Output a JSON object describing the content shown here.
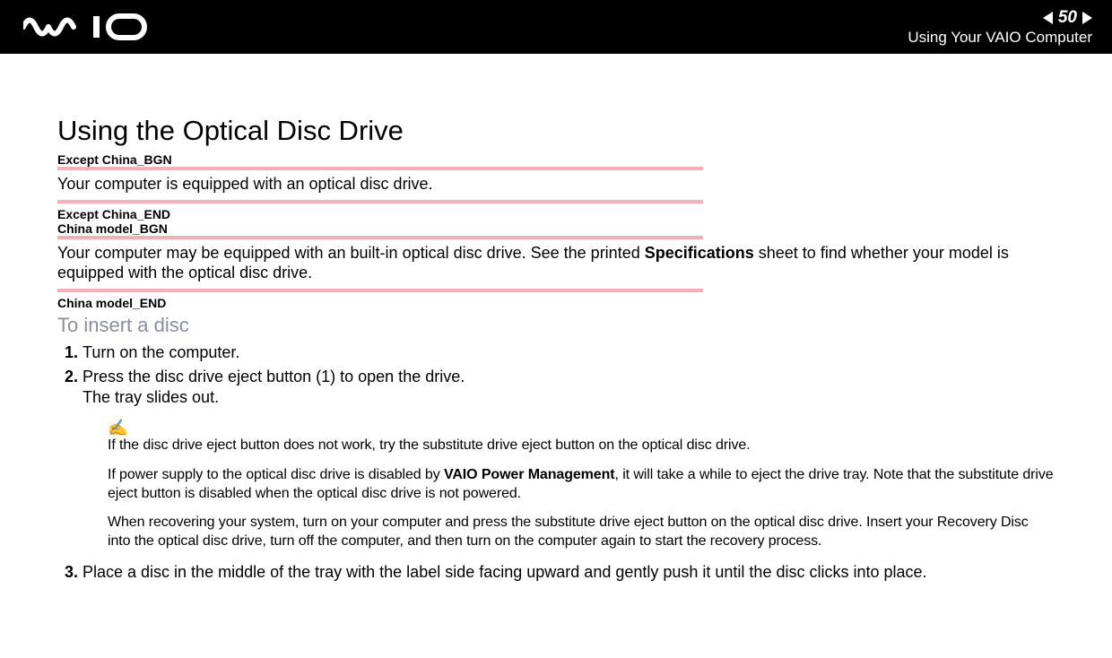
{
  "header": {
    "page_number": "50",
    "subtitle": "Using Your VAIO Computer"
  },
  "title": "Using the Optical Disc Drive",
  "markers": {
    "except_china_bgn": "Except China_BGN",
    "except_china_end": "Except China_END",
    "china_model_bgn": "China model_BGN",
    "china_model_end": "China model_END"
  },
  "para1": "Your computer is equipped with an optical disc drive.",
  "para2_pre": "Your computer may be equipped with an built-in optical disc drive. See the printed ",
  "para2_bold": "Specifications",
  "para2_post": " sheet to find whether your model is equipped with the optical disc drive.",
  "subheading": "To insert a disc",
  "steps": {
    "s1": "Turn on the computer.",
    "s2a": "Press the disc drive eject button (1) to open the drive.",
    "s2b": "The tray slides out.",
    "s3": "Place a disc in the middle of the tray with the label side facing upward and gently push it until the disc clicks into place."
  },
  "notes": {
    "icon": "✍",
    "n1": "If the disc drive eject button does not work, try the substitute drive eject button on the optical disc drive.",
    "n2_pre": "If power supply to the optical disc drive is disabled by ",
    "n2_bold": "VAIO Power Management",
    "n2_post": ", it will take a while to eject the drive tray. Note that the substitute drive eject button is disabled when the optical disc drive is not powered.",
    "n3": "When recovering your system, turn on your computer and press the substitute drive eject button on the optical disc drive. Insert your Recovery Disc into the optical disc drive, turn off the computer, and then turn on the computer again to start the recovery process."
  }
}
